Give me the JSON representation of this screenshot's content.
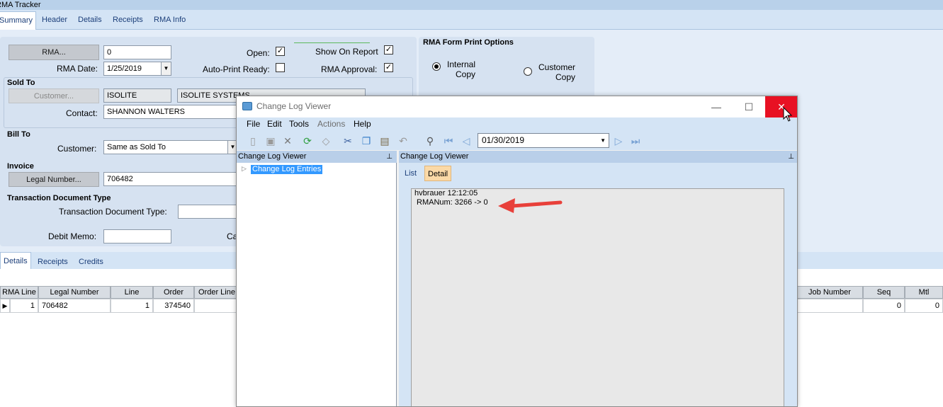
{
  "app": {
    "title": "RMA Tracker",
    "tabs": [
      "Summary",
      "Header",
      "Details",
      "Receipts",
      "RMA Info"
    ]
  },
  "summary": {
    "rma_button": "RMA...",
    "rma_value": "0",
    "rma_date_label": "RMA Date:",
    "rma_date_value": "1/25/2019",
    "open_label": "Open:",
    "auto_print_label": "Auto-Print Ready:",
    "show_on_report_label": "Show On Report",
    "rma_approval_label": "RMA Approval:",
    "sold_to_title": "Sold To",
    "customer_button": "Customer...",
    "customer_id": "ISOLITE",
    "customer_name": "ISOLITE SYSTEMS",
    "contact_label": "Contact:",
    "contact_value": "SHANNON WALTERS",
    "bill_to_title": "Bill To",
    "bill_customer_label": "Customer:",
    "bill_customer_value": "Same as Sold To",
    "invoice_title": "Invoice",
    "legal_number_button": "Legal Number...",
    "legal_number_value": "706482",
    "tdt_title": "Transaction Document Type",
    "tdt_label": "Transaction Document Type:",
    "debit_memo_label": "Debit Memo:",
    "partial_label": "Ca"
  },
  "print_options": {
    "title": "RMA Form Print Options",
    "internal_copy": "Internal\nCopy",
    "internal_line1": "Internal",
    "internal_line2": "Copy",
    "customer_line1": "Customer",
    "customer_line2": "Copy"
  },
  "sub_tabs": [
    "Details",
    "Receipts",
    "Credits"
  ],
  "grid": {
    "headers": {
      "rma_line": "RMA Line",
      "legal_number": "Legal Number",
      "line": "Line",
      "order": "Order",
      "order_line": "Order Line",
      "job_number": "Job Number",
      "seq": "Seq",
      "mtl": "Mtl"
    },
    "row": {
      "rma_line": "1",
      "legal_number": "706482",
      "line": "1",
      "order": "374540",
      "seq": "0",
      "mtl": "0"
    }
  },
  "dialog": {
    "title": "Change Log Viewer",
    "menu": [
      "File",
      "Edit",
      "Tools",
      "Actions",
      "Help"
    ],
    "date_value": "01/30/2019",
    "left_pane_title": "Change Log Viewer",
    "right_pane_title": "Change Log Viewer",
    "tree_item": "Change Log Entries",
    "tabs": [
      "List",
      "Detail"
    ],
    "log_user_time": "hvbrauer 12:12:05",
    "log_change": "RMANum: 3266 -> 0"
  },
  "colors": {
    "accent_blue": "#d4e4f5",
    "close_red": "#e81123",
    "arrow_red": "#e8403a",
    "selection": "#3399ff"
  }
}
